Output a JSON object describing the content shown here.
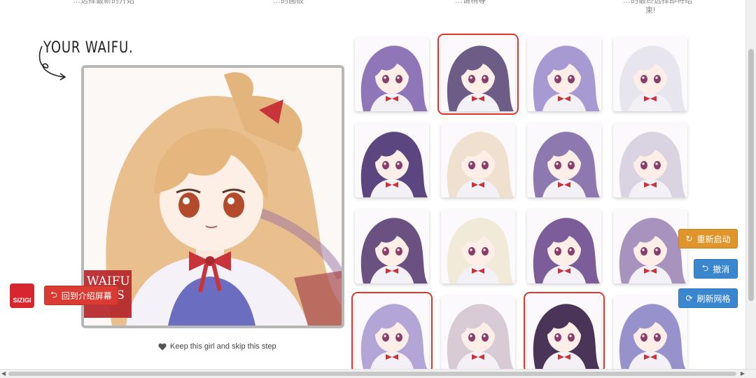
{
  "top_snippets": [
    "…选择最新的开始",
    "…的画板",
    "…请稍等",
    "…的最终选择即将结",
    "束!"
  ],
  "title": "YOUR WAIFU.",
  "logo_text": [
    "WAIFU",
    "LABS"
  ],
  "keep_link": "Keep this girl and skip this step",
  "buttons": {
    "restart": "重新启动",
    "undo": "撤消",
    "refresh": "刷新网格",
    "back_intro": "回到介绍屏幕"
  },
  "brand": "SIZIGI",
  "grid": {
    "tiles": [
      {
        "hair": "#8e76b8",
        "selected": false
      },
      {
        "hair": "#6d5c85",
        "selected": true
      },
      {
        "hair": "#a79ad3",
        "selected": false
      },
      {
        "hair": "#e7e6ef",
        "selected": false
      },
      {
        "hair": "#5b4680",
        "selected": false
      },
      {
        "hair": "#efe0cf",
        "selected": false
      },
      {
        "hair": "#8d78b0",
        "selected": false
      },
      {
        "hair": "#d9d3e2",
        "selected": false
      },
      {
        "hair": "#6a5181",
        "selected": false
      },
      {
        "hair": "#f2ead8",
        "selected": false
      },
      {
        "hair": "#7c5d9a",
        "selected": false
      },
      {
        "hair": "#a893bf",
        "selected": false
      },
      {
        "hair": "#b3a5d5",
        "selected": true
      },
      {
        "hair": "#d8cbd6",
        "selected": false
      },
      {
        "hair": "#4a3457",
        "selected": true
      },
      {
        "hair": "#9791cc",
        "selected": false
      }
    ]
  },
  "colors": {
    "main_hair": "#e9c08d",
    "accent_orange": "#e0952b",
    "accent_blue": "#3a86cf",
    "accent_red": "#d93b33",
    "selection": "#e5322d"
  }
}
